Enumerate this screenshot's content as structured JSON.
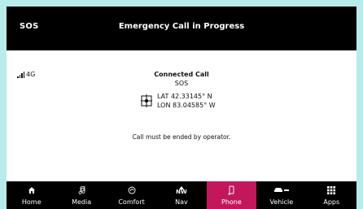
{
  "header": {
    "left_label": "SOS",
    "title": "Emergency Call in Progress"
  },
  "status": {
    "network_label": "4G"
  },
  "call": {
    "state": "Connected Call",
    "service": "SOS",
    "lat_label": "LAT",
    "lat_value": "42.33145° N",
    "lon_label": "LON",
    "lon_value": "83.04585° W",
    "note": "Call must be ended by operator."
  },
  "nav": {
    "items": [
      {
        "label": "Home",
        "icon": "home-icon"
      },
      {
        "label": "Media",
        "icon": "music-note-icon"
      },
      {
        "label": "Comfort",
        "icon": "comfort-icon"
      },
      {
        "label": "Nav",
        "icon": "compass-icon"
      },
      {
        "label": "Phone",
        "icon": "phone-icon",
        "active": true
      },
      {
        "label": "Vehicle",
        "icon": "car-icon"
      },
      {
        "label": "Apps",
        "icon": "grid-icon"
      }
    ],
    "nav_icon_text": "NW"
  },
  "colors": {
    "active": "#c2185b",
    "background": "#b8ecea"
  }
}
